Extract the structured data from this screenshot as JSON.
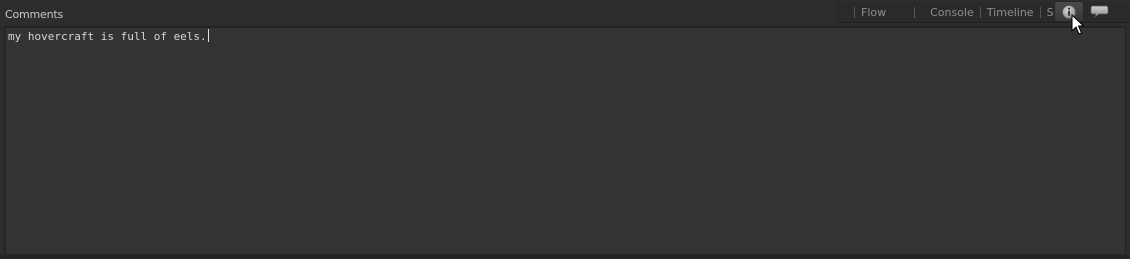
{
  "panel": {
    "title": "Comments"
  },
  "toolbar": {
    "tabs": [
      {
        "label": "Flow"
      },
      {
        "label": "Console"
      },
      {
        "label": "Timeline"
      },
      {
        "label": "Spline"
      }
    ],
    "info_icon": "info-icon",
    "comment_icon": "speech-bubble-icon"
  },
  "editor": {
    "text": "my hovercraft is full of eels."
  }
}
